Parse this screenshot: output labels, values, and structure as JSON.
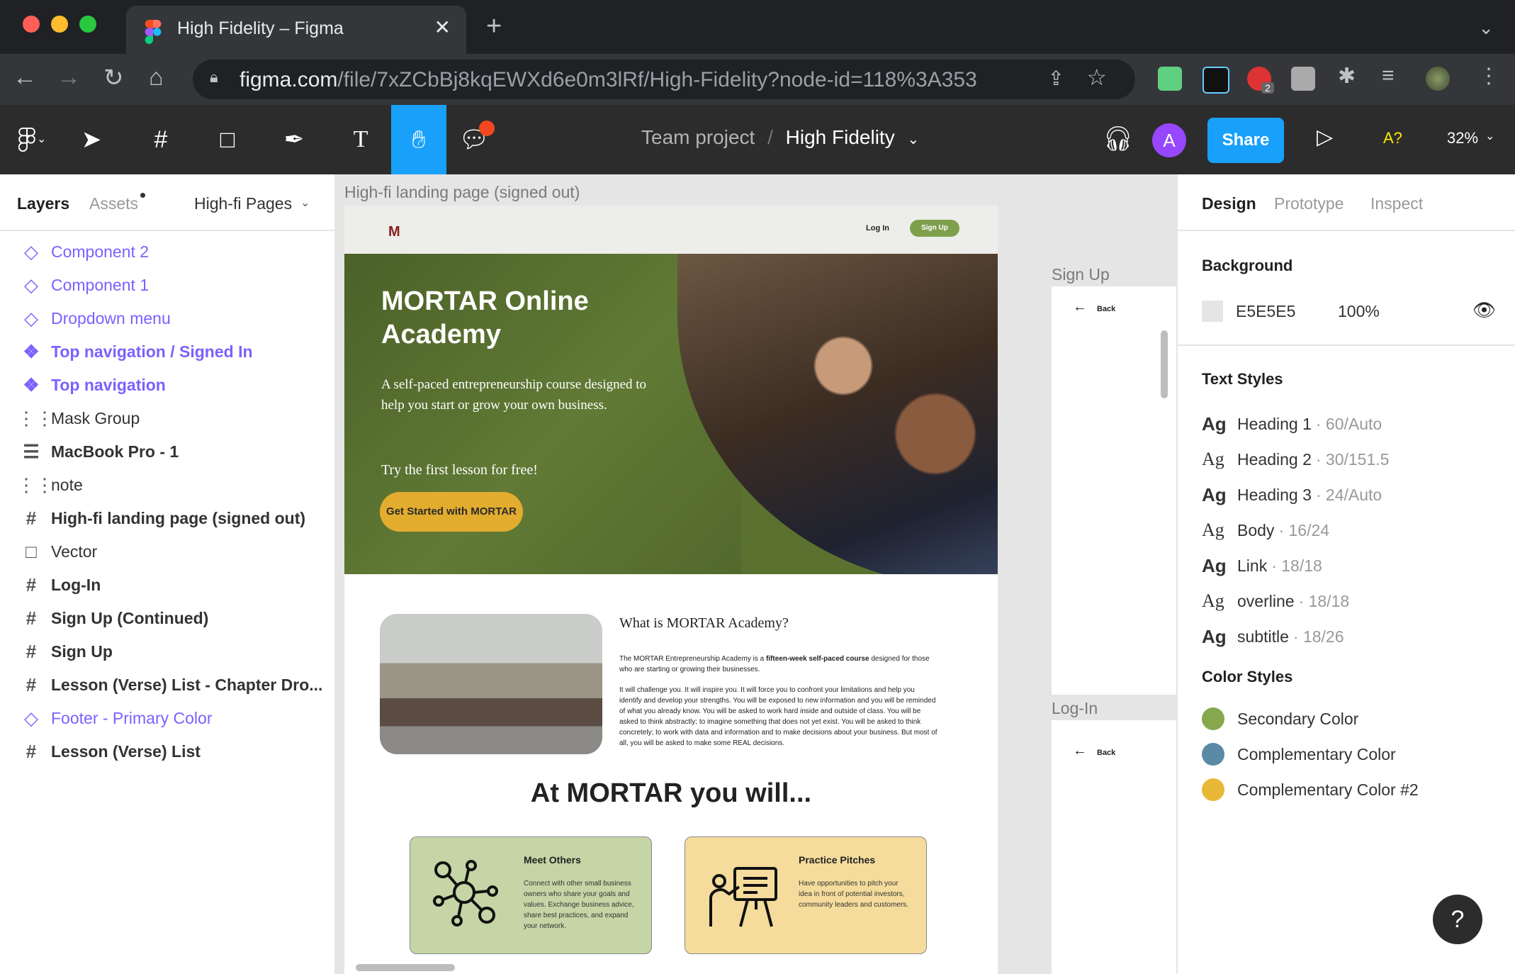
{
  "browser": {
    "tab_title": "High Fidelity – Figma",
    "tab_close": "✕",
    "new_tab": "+",
    "url_host": "figma.com",
    "url_path": "/file/7xZCbBj8kqEWXd6e0m3lRf/High-Fidelity?node-id=118%3A353",
    "ext_badge": "2"
  },
  "toolbar": {
    "project": "Team project",
    "separator": "/",
    "file": "High Fidelity",
    "avatar_letter": "A",
    "share": "Share",
    "font_missing": "A?",
    "zoom": "32%"
  },
  "left_panel": {
    "tab_layers": "Layers",
    "tab_assets": "Assets",
    "pages_dropdown": "High-fi Pages",
    "layers": [
      {
        "name": "Component 2",
        "kind": "component-instance"
      },
      {
        "name": "Component 1",
        "kind": "component-instance"
      },
      {
        "name": "Dropdown menu",
        "kind": "component-instance"
      },
      {
        "name": "Top navigation / Signed In",
        "kind": "component"
      },
      {
        "name": "Top navigation",
        "kind": "component"
      },
      {
        "name": "Mask Group",
        "kind": "group"
      },
      {
        "name": "MacBook Pro - 1",
        "kind": "auto-layout"
      },
      {
        "name": "note",
        "kind": "group"
      },
      {
        "name": "High-fi landing page (signed out)",
        "kind": "frame"
      },
      {
        "name": "Vector",
        "kind": "rectangle"
      },
      {
        "name": "Log-In",
        "kind": "frame"
      },
      {
        "name": "Sign Up (Continued)",
        "kind": "frame"
      },
      {
        "name": "Sign Up",
        "kind": "frame"
      },
      {
        "name": "Lesson (Verse) List - Chapter Dro...",
        "kind": "frame"
      },
      {
        "name": "Footer - Primary Color",
        "kind": "component-instance"
      },
      {
        "name": "Lesson (Verse) List",
        "kind": "frame"
      }
    ]
  },
  "canvas": {
    "frame_label": "High-fi landing page (signed out)",
    "site": {
      "logo": "M",
      "login": "Log In",
      "signup": "Sign Up",
      "hero_title": "MORTAR Online Academy",
      "hero_sub": "A self-paced entrepreneurship course designed to help you start or grow your own business.",
      "hero_try": "Try the first lesson for free!",
      "hero_btn": "Get Started with MORTAR",
      "about_title": "What is MORTAR Academy?",
      "about_p1_a": "The MORTAR Entrepreneurship Academy is a ",
      "about_p1_b": "fifteen-week self-paced course",
      "about_p1_c": " designed for those who are starting or growing their businesses.",
      "about_p2": "It will challenge you. It will inspire you. It will force you to confront your limitations and help you identify and develop your strengths. You will be exposed to new information and you will be reminded of what you already know. You will be asked to work hard inside and outside of class. You will be asked to think abstractly; to imagine something that does not yet exist. You will be asked to think concretely; to work with data and information and to make decisions about your business. But most of all, you will be asked to make some REAL decisions.",
      "will_heading": "At MORTAR you will...",
      "cards": [
        {
          "title": "Meet Others",
          "text": "Connect with other small business owners who share your goals and values. Exchange business advice, share best practices, and expand your network.",
          "bg": "#c5d5a6"
        },
        {
          "title": "Practice Pitches",
          "text": "Have opportunities to pitch your idea in front of potential investors, community leaders and customers.",
          "bg": "#f5dc9c"
        }
      ]
    },
    "signup_label": "Sign Up",
    "login_label": "Log-In",
    "back": "Back"
  },
  "right_panel": {
    "tab_design": "Design",
    "tab_prototype": "Prototype",
    "tab_inspect": "Inspect",
    "background_title": "Background",
    "background_hex": "E5E5E5",
    "background_opacity": "100%",
    "text_styles_title": "Text Styles",
    "text_styles": [
      {
        "sample": "Ag",
        "name": "Heading 1",
        "meta": "· 60/Auto",
        "serif": false
      },
      {
        "sample": "Ag",
        "name": "Heading 2",
        "meta": "· 30/151.5",
        "serif": true
      },
      {
        "sample": "Ag",
        "name": "Heading 3",
        "meta": "· 24/Auto",
        "serif": false
      },
      {
        "sample": "Ag",
        "name": "Body",
        "meta": "· 16/24",
        "serif": true
      },
      {
        "sample": "Ag",
        "name": "Link",
        "meta": "· 18/18",
        "serif": false
      },
      {
        "sample": "Ag",
        "name": "overline",
        "meta": "· 18/18",
        "serif": true
      },
      {
        "sample": "Ag",
        "name": "subtitle",
        "meta": "· 18/26",
        "serif": false
      }
    ],
    "color_styles_title": "Color Styles",
    "color_styles": [
      {
        "name": "Secondary Color",
        "color": "#86a84c"
      },
      {
        "name": "Complementary Color",
        "color": "#5b8aa6"
      },
      {
        "name": "Complementary Color #2",
        "color": "#e8b836"
      }
    ],
    "help": "?"
  },
  "colors": {
    "figma_blue": "#18a0fb",
    "component_purple": "#7b61ff",
    "hero_green": "#5a7130",
    "mortar_gold": "#e2ac2e"
  }
}
